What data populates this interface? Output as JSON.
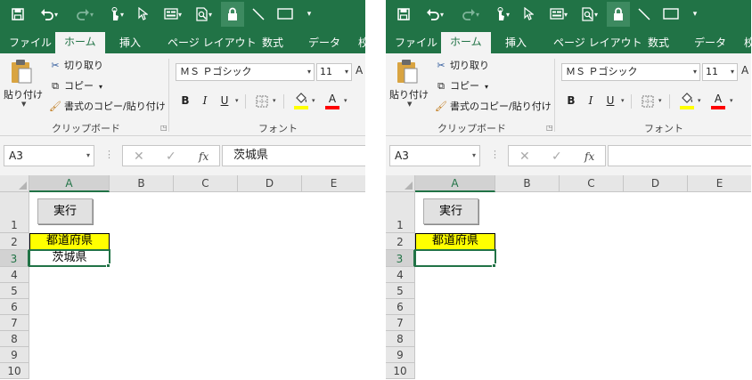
{
  "qat": {
    "icons": [
      "save-icon",
      "undo-icon",
      "redo-icon",
      "touch-mode-icon",
      "select-objects-icon",
      "form-icon",
      "print-preview-icon",
      "lock-icon",
      "line-icon",
      "rectangle-icon",
      "customize-icon"
    ]
  },
  "tabs": [
    {
      "label": "ファイル"
    },
    {
      "label": "ホーム"
    },
    {
      "label": "挿入"
    },
    {
      "label": "ページ レイアウト"
    },
    {
      "label": "数式"
    },
    {
      "label": "データ"
    },
    {
      "label": "校"
    }
  ],
  "ribbon": {
    "paste_label": "貼り付け",
    "cut_label": "切り取り",
    "copy_label": "コピー",
    "format_painter_label": "書式のコピー/貼り付け",
    "clipboard_group": "クリップボード",
    "font_name": "ＭＳ Ｐゴシック",
    "font_size": "11",
    "grow_label": "A",
    "bold_label": "B",
    "italic_label": "I",
    "underline_label": "U",
    "font_color_label": "A",
    "font_group": "フォント",
    "fill_color": "#ffff00",
    "font_color": "#ff0000"
  },
  "accent_color": "#217346",
  "left": {
    "name_box": "A3",
    "formula_value": "茨城県",
    "cell_a2": "都道府県",
    "cell_a3": "茨城県"
  },
  "right": {
    "name_box": "A3",
    "formula_value": "",
    "cell_a2": "都道府県",
    "cell_a3": ""
  },
  "sheet": {
    "button_label": "実行",
    "columns": [
      "A",
      "B",
      "C",
      "D",
      "E"
    ],
    "rows": [
      "1",
      "2",
      "3",
      "4",
      "5",
      "6",
      "7",
      "8",
      "9",
      "10"
    ]
  }
}
